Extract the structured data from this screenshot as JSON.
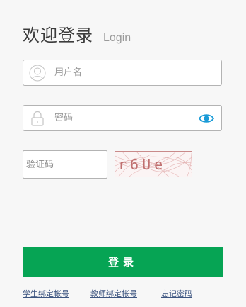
{
  "header": {
    "title": "欢迎登录",
    "subtitle": "Login"
  },
  "form": {
    "username": {
      "placeholder": "用户名",
      "value": "",
      "icon": "user-icon"
    },
    "password": {
      "placeholder": "密码",
      "value": "",
      "icon": "lock-icon",
      "toggle_icon": "eye-icon"
    },
    "captcha": {
      "placeholder": "验证码",
      "value": "",
      "image_text": "r6Ue"
    },
    "submit_label": "登录"
  },
  "links": {
    "student_bind": "学生绑定帐号",
    "teacher_bind": "教师绑定帐号",
    "forgot_password": "忘记密码"
  },
  "colors": {
    "accent": "#06a454",
    "eye": "#1a9bd7",
    "link": "#3d5580",
    "captcha_text": "#c07070"
  }
}
